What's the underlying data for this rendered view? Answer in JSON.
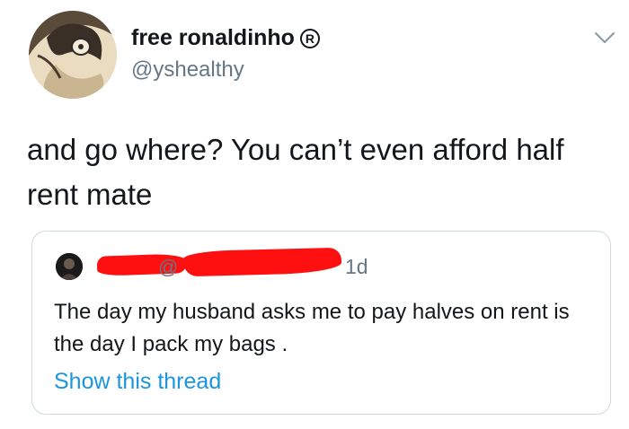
{
  "user": {
    "display_name": "free ronaldinho",
    "registered_mark": "R",
    "handle": "@yshealthy"
  },
  "tweet": {
    "text": "and go where? You can’t even afford half rent mate"
  },
  "quoted_tweet": {
    "handle_prefix": "@",
    "time": "1d",
    "text": "The day my husband asks me to pay halves on rent is the day I pack my bags .",
    "thread_link": "Show this thread"
  },
  "icons": {
    "menu": "chevron-down-icon"
  },
  "colors": {
    "text": "#14171a",
    "secondary": "#657786",
    "link": "#1b95e0",
    "redaction": "#ff1010",
    "border": "#cfd9de"
  }
}
